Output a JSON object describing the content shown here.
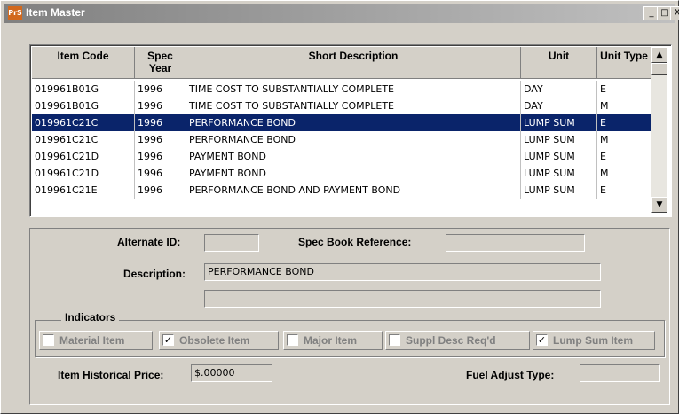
{
  "window": {
    "title": "Item Master",
    "icon_text": "PrS",
    "controls": [
      "_",
      "□",
      "X"
    ]
  },
  "grid": {
    "headers": [
      "Item Code",
      "Spec Year",
      "Short Description",
      "Unit",
      "Unit Type"
    ],
    "rows": [
      {
        "item_code": "019961B01G",
        "spec_year": "1996",
        "short_description": "TIME COST TO SUBSTANTIALLY COMPLETE",
        "unit": "DAY",
        "unit_type": "E",
        "selected": false
      },
      {
        "item_code": "019961B01G",
        "spec_year": "1996",
        "short_description": "TIME COST TO SUBSTANTIALLY COMPLETE",
        "unit": "DAY",
        "unit_type": "M",
        "selected": false
      },
      {
        "item_code": "019961C21C",
        "spec_year": "1996",
        "short_description": "PERFORMANCE BOND",
        "unit": "LUMP SUM",
        "unit_type": "E",
        "selected": true
      },
      {
        "item_code": "019961C21C",
        "spec_year": "1996",
        "short_description": "PERFORMANCE BOND",
        "unit": "LUMP SUM",
        "unit_type": "M",
        "selected": false
      },
      {
        "item_code": "019961C21D",
        "spec_year": "1996",
        "short_description": "PAYMENT BOND",
        "unit": "LUMP SUM",
        "unit_type": "E",
        "selected": false
      },
      {
        "item_code": "019961C21D",
        "spec_year": "1996",
        "short_description": "PAYMENT BOND",
        "unit": "LUMP SUM",
        "unit_type": "M",
        "selected": false
      },
      {
        "item_code": "019961C21E",
        "spec_year": "1996",
        "short_description": "PERFORMANCE BOND AND PAYMENT BOND",
        "unit": "LUMP SUM",
        "unit_type": "E",
        "selected": false
      }
    ]
  },
  "form": {
    "alternate_id_label": "Alternate ID:",
    "alternate_id_value": "",
    "spec_book_label": "Spec Book Reference:",
    "spec_book_value": "",
    "description_label": "Description:",
    "description_value": "PERFORMANCE BOND",
    "description_value2": "",
    "indicators_label": "Indicators",
    "indicators": [
      {
        "label": "Material Item",
        "checked": false
      },
      {
        "label": "Obsolete Item",
        "checked": true
      },
      {
        "label": "Major Item",
        "checked": false
      },
      {
        "label": "Suppl Desc Req'd",
        "checked": false
      },
      {
        "label": "Lump Sum Item",
        "checked": true
      }
    ],
    "historical_price_label": "Item Historical Price:",
    "historical_price_value": "$.00000",
    "fuel_adjust_label": "Fuel Adjust Type:",
    "fuel_adjust_value": ""
  },
  "colors": {
    "selection": "#0a246a",
    "face": "#d4d0c8"
  }
}
